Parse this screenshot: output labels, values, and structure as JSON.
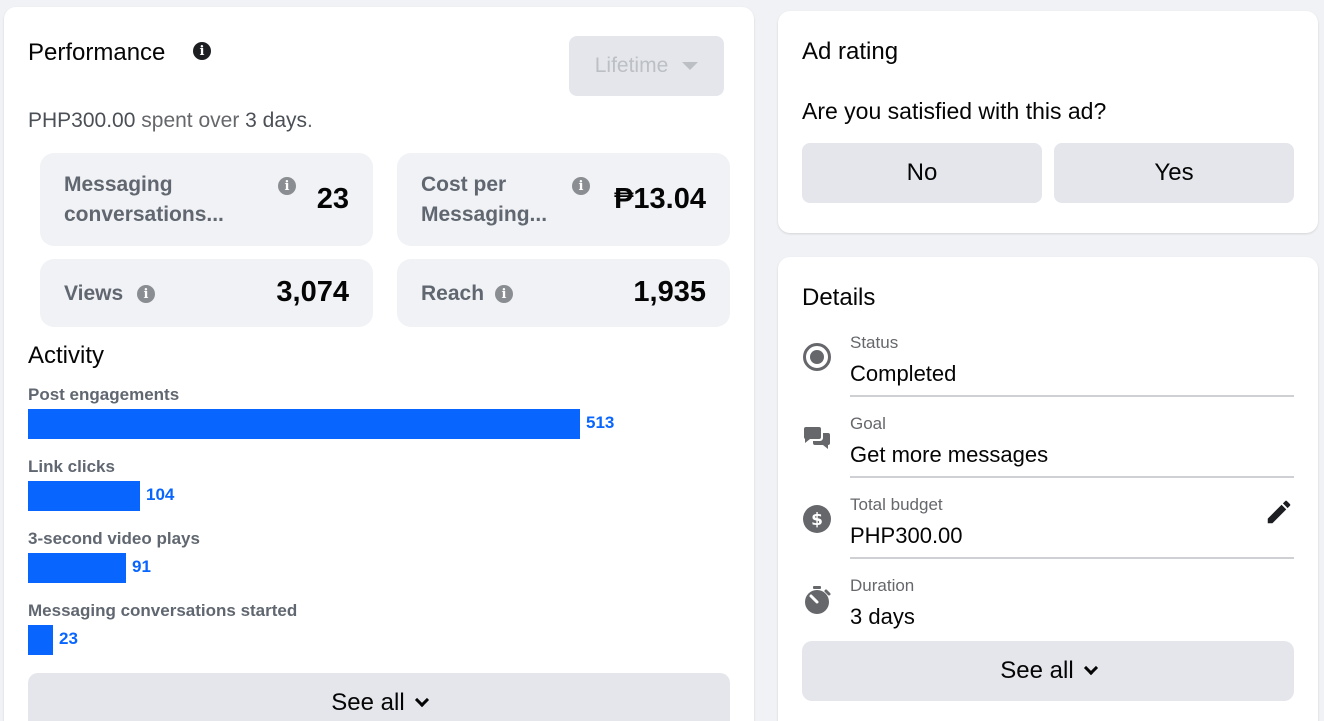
{
  "performance": {
    "title": "Performance",
    "info_icon": "info-icon",
    "range_button": "Lifetime",
    "spent_amount": "PHP300.00",
    "spent_text": "spent over",
    "spent_days": "3 days",
    "spent_end": ".",
    "metrics": [
      {
        "label_line1": "Messaging",
        "label_line2": "conversations...",
        "value": "23"
      },
      {
        "label_line1": "Cost per",
        "label_line2": "Messaging...",
        "value": "₱13.04"
      },
      {
        "label_line1": "Views",
        "value": "3,074"
      },
      {
        "label_line1": "Reach",
        "value": "1,935"
      }
    ]
  },
  "activity": {
    "title": "Activity",
    "items": [
      {
        "label": "Post engagements",
        "value": 513,
        "fraction": 1.0
      },
      {
        "label": "Link clicks",
        "value": 104,
        "fraction": 0.2027
      },
      {
        "label": "3-second video plays",
        "value": 91,
        "fraction": 0.1774
      },
      {
        "label": "Messaging conversations started",
        "value": 23,
        "fraction": 0.0448
      }
    ],
    "bar_color": "#0866ff",
    "see_all": "See all"
  },
  "ad_rating": {
    "title": "Ad rating",
    "question": "Are you satisfied with this ad?",
    "no_label": "No",
    "yes_label": "Yes"
  },
  "details": {
    "title": "Details",
    "rows": [
      {
        "icon": "status-radio-icon",
        "label": "Status",
        "value": "Completed"
      },
      {
        "icon": "chat-bubbles-icon",
        "label": "Goal",
        "value": "Get more messages"
      },
      {
        "icon": "dollar-circle-icon",
        "label": "Total budget",
        "value": "PHP300.00",
        "edit_icon": "pencil-icon"
      },
      {
        "icon": "stopwatch-icon",
        "label": "Duration",
        "value": "3 days"
      }
    ],
    "see_all": "See all"
  }
}
